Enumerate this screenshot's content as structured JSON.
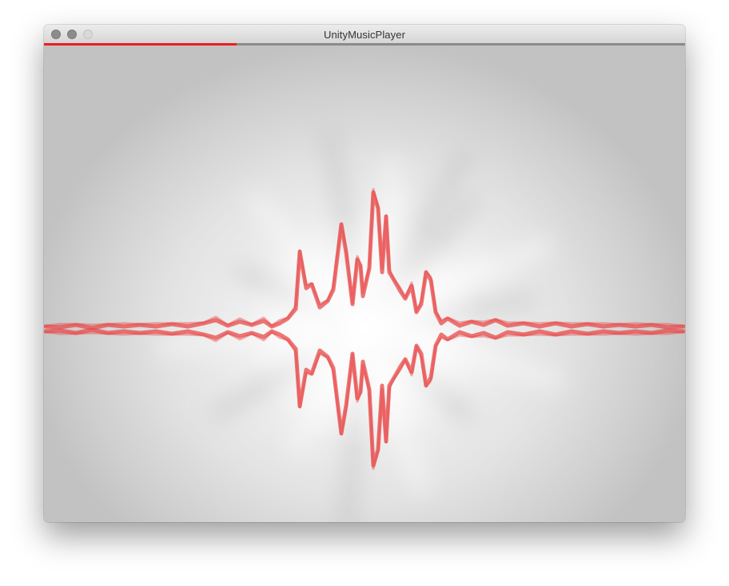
{
  "window": {
    "title": "UnityMusicPlayer"
  },
  "playback": {
    "progress": 0.3
  },
  "visualizer": {
    "color": "#e84a4a",
    "glow_color": "#ffffff"
  },
  "controls": [
    {
      "name": "eject-icon"
    },
    {
      "name": "stop-icon"
    },
    {
      "name": "play-icon"
    },
    {
      "name": "next-track-icon"
    },
    {
      "name": "settings-icon"
    }
  ],
  "colors": {
    "accent": "#ee1c1c",
    "background": "#e6e6e6"
  }
}
